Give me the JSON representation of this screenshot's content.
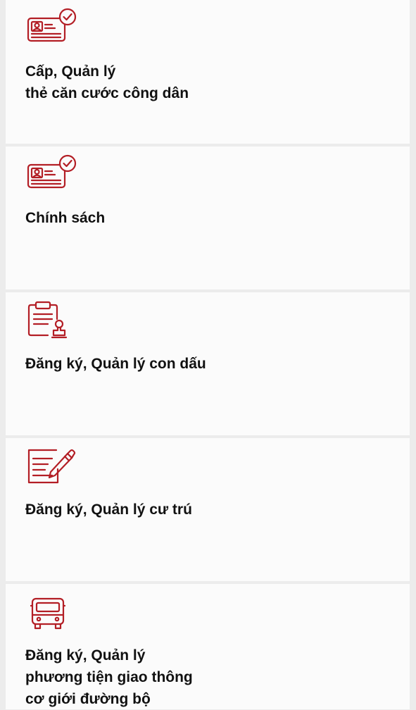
{
  "theme": {
    "accent": "#b31e25",
    "card_background": "#fbfbfb",
    "page_background": "#ececec",
    "text": "#111111"
  },
  "services": [
    {
      "icon": "id-card-check-icon",
      "label": "Cấp, Quản lý\nthẻ căn cước công dân"
    },
    {
      "icon": "id-card-check-icon",
      "label": "Chính sách"
    },
    {
      "icon": "clipboard-stamp-icon",
      "label": "Đăng ký, Quản lý con dấu"
    },
    {
      "icon": "document-pen-icon",
      "label": "Đăng ký, Quản lý cư trú"
    },
    {
      "icon": "vehicle-icon",
      "label": "Đăng ký, Quản lý\nphương tiện giao thông\ncơ giới đường bộ"
    }
  ]
}
